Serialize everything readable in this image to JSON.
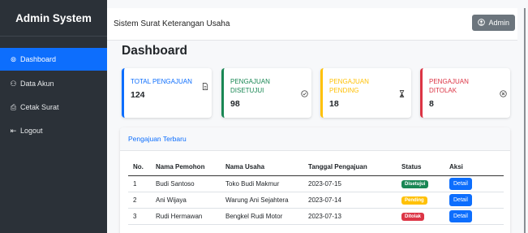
{
  "sidebar": {
    "brand": "Admin System",
    "items": [
      {
        "icon": "dashboard-icon",
        "glyph": "⊚",
        "label": "Dashboard",
        "active": true
      },
      {
        "icon": "users-icon",
        "glyph": "⚇",
        "label": "Data Akun",
        "active": false
      },
      {
        "icon": "printer-icon",
        "glyph": "⎙",
        "label": "Cetak Surat",
        "active": false
      },
      {
        "icon": "logout-icon",
        "glyph": "⇤",
        "label": "Logout",
        "active": false
      }
    ]
  },
  "topbar": {
    "title": "Sistem Surat Keterangan Usaha",
    "user_button": "Admin",
    "user_icon": "user-circle-icon"
  },
  "page": {
    "title": "Dashboard"
  },
  "cards": [
    {
      "label": "TOTAL PENGAJUAN",
      "value": "124",
      "icon": "document-icon",
      "glyph": "🗎",
      "color": "#0d6efd"
    },
    {
      "label": "PENGAJUAN DISETUJUI",
      "value": "98",
      "icon": "check-circle-icon",
      "glyph": "⊘",
      "color": "#198754"
    },
    {
      "label": "PENGAJUAN PENDING",
      "value": "18",
      "icon": "hourglass-icon",
      "glyph": "⧗",
      "color": "#ffc107"
    },
    {
      "label": "PENGAJUAN DITOLAK",
      "value": "8",
      "icon": "x-circle-icon",
      "glyph": "⊗",
      "color": "#dc3545"
    }
  ],
  "recent": {
    "header": "Pengajuan Terbaru",
    "columns": [
      "No.",
      "Nama Pemohon",
      "Nama Usaha",
      "Tanggal Pengajuan",
      "Status",
      "Aksi"
    ],
    "rows": [
      {
        "no": "1",
        "nama": "Budi Santoso",
        "usaha": "Toko Budi Makmur",
        "tanggal": "2023-07-15",
        "status": "Disetujui",
        "status_color": "#198754",
        "status_text_color": "#ffffff",
        "aksi": "Detail"
      },
      {
        "no": "2",
        "nama": "Ani Wijaya",
        "usaha": "Warung Ani Sejahtera",
        "tanggal": "2023-07-14",
        "status": "Pending",
        "status_color": "#ffc107",
        "status_text_color": "#ffffff",
        "aksi": "Detail"
      },
      {
        "no": "3",
        "nama": "Rudi Hermawan",
        "usaha": "Bengkel Rudi Motor",
        "tanggal": "2023-07-13",
        "status": "Ditolak",
        "status_color": "#dc3545",
        "status_text_color": "#ffffff",
        "aksi": "Detail"
      }
    ]
  }
}
